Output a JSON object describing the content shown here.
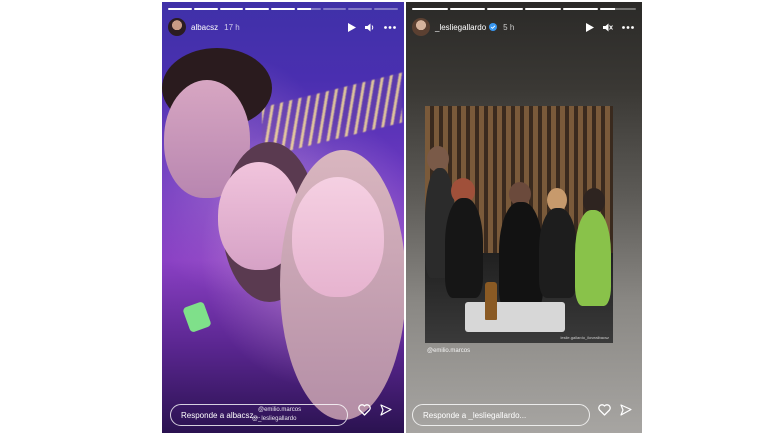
{
  "stories": {
    "left": {
      "username": "albacsz",
      "time": "17 h",
      "reply_placeholder": "Responde a albacsz...",
      "mentions": [
        "@emilio.marcos",
        "@_lesliegallardo"
      ]
    },
    "right": {
      "username": "_lesliegallardo",
      "time": "5 h",
      "reply_placeholder": "Responde a _lesliegallardo...",
      "mention": "@emilio.marcos",
      "photo_caption": "leslie.gallardo_ilovealbacsz"
    }
  },
  "icons": {
    "play": "play-icon",
    "volume": "volume-icon",
    "muted": "muted-icon",
    "more": "more-icon",
    "heart": "heart-icon",
    "send": "send-icon",
    "verified": "verified-badge-icon"
  },
  "colors": {
    "left_bg": "#4a2fb0",
    "right_bg": "#3a3834",
    "text": "#ffffff",
    "verified": "#3897f0"
  }
}
